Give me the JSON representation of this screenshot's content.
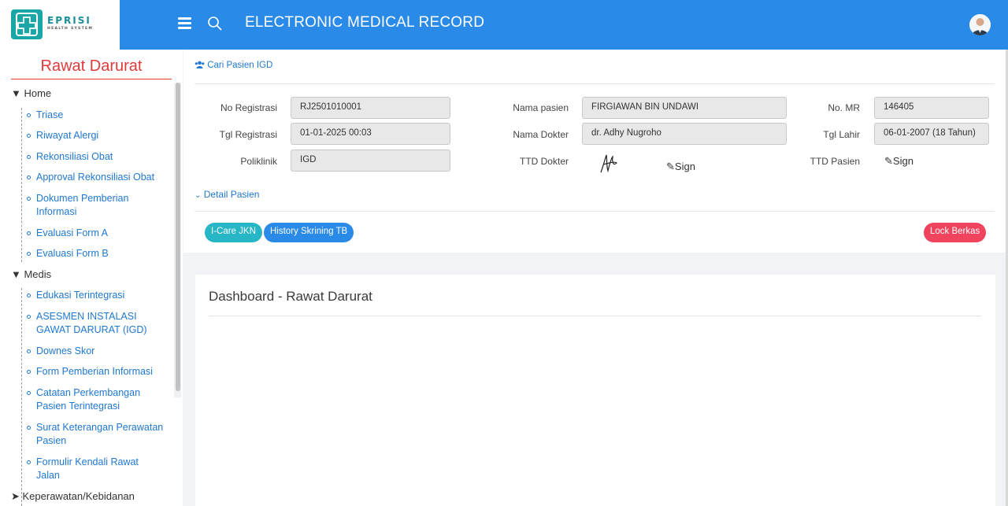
{
  "brand": {
    "name": "EPRISI",
    "tagline": "HEALTH SYSTEM",
    "color": "#1aa6a6"
  },
  "header": {
    "title": "ELECTRONIC MEDICAL RECORD",
    "bg": "#2a8ae8"
  },
  "sidebar": {
    "title": "Rawat Darurat",
    "groups": [
      {
        "label": "▼ Home"
      },
      {
        "label": "▼ Medis"
      },
      {
        "label": "➤ Keperawatan/Kebidanan"
      }
    ],
    "home_items": [
      "Triase",
      "Riwayat Alergi",
      "Rekonsiliasi Obat",
      "Approval Rekonsiliasi Obat",
      "Dokumen Pemberian Informasi",
      "Evaluasi Form A",
      "Evaluasi Form B"
    ],
    "medis_items": [
      "Edukasi Terintegrasi",
      "ASESMEN INSTALASI GAWAT DARURAT (IGD)",
      "Downes Skor",
      "Form Pemberian Informasi",
      "Catatan Perkembangan Pasien Terintegrasi",
      "Surat Keterangan Perawatan Pasien",
      "Formulir Kendali Rawat Jalan"
    ]
  },
  "patient": {
    "cari_link": "Cari Pasien IGD",
    "no_registrasi_label": "No Registrasi",
    "no_registrasi": "RJ2501010001",
    "tgl_registrasi_label": "Tgl Registrasi",
    "tgl_registrasi": "01-01-2025 00:03",
    "poliklinik_label": "Poliklinik",
    "poliklinik": "IGD",
    "nama_pasien_label": "Nama pasien",
    "nama_pasien": "FIRGIAWAN BIN UNDAWI",
    "nama_dokter_label": "Nama Dokter",
    "nama_dokter": "dr. Adhy Nugroho",
    "ttd_dokter_label": "TTD Dokter",
    "no_mr_label": "No. MR",
    "no_mr": "146405",
    "tgl_lahir_label": "Tgl Lahir",
    "tgl_lahir": "06-01-2007 (18 Tahun)",
    "ttd_pasien_label": "TTD Pasien",
    "sign_label": "Sign",
    "detail_link": "Detail Pasien"
  },
  "actions": {
    "icare": "I-Care JKN",
    "history": "History Skrining TB",
    "lock": "Lock Berkas",
    "colors": {
      "icare": "#26b6c6",
      "history": "#2a8ae8",
      "lock": "#f0435e"
    }
  },
  "dashboard": {
    "title": "Dashboard - Rawat Darurat"
  }
}
